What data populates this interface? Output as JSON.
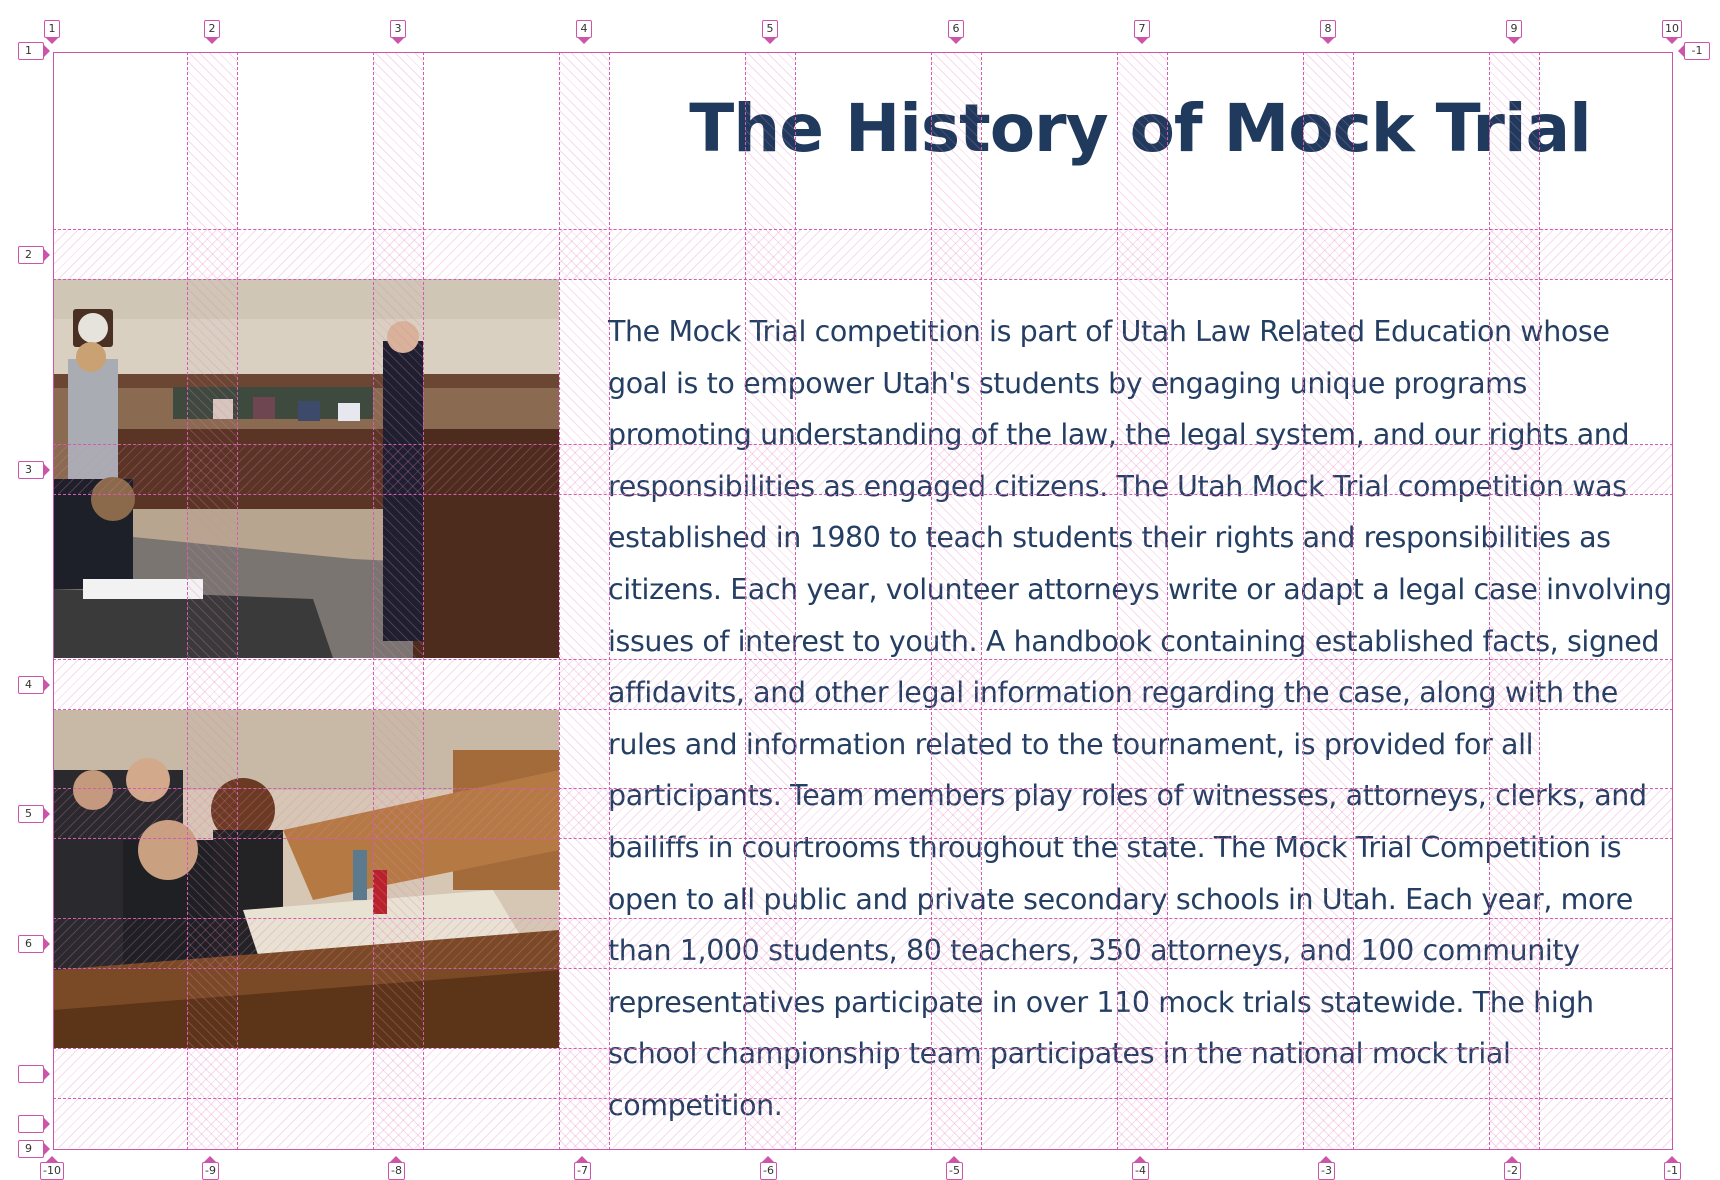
{
  "page": {
    "title": "The History of Mock Trial",
    "paragraph": "The Mock Trial competition is part of Utah Law Related Education whose goal is to empower Utah's students by engaging unique programs promoting understanding of the law, the legal system, and our rights and responsibilities as engaged citizens. The Utah Mock Trial competition was established in 1980 to teach students their rights and responsibilities as citizens. Each year, volunteer attorneys write or adapt a legal case involving issues of interest to youth. A handbook containing established facts, signed affidavits, and other legal information regarding the case, along with the rules and information related to the tournament, is provided for all participants. Team members play roles of witnesses, attorneys, clerks, and bailiffs in courtrooms throughout the state. The Mock Trial Competition is open to all public and private secondary schools in Utah. Each year, more than 1,000 students, 80 teachers, 350 attorneys, and 100 community representatives participate in over 110 mock trials statewide. The high school championship team participates in the national mock trial competition."
  },
  "grid_overlay": {
    "column_labels_top": [
      "1",
      "2",
      "3",
      "4",
      "5",
      "6",
      "7",
      "8",
      "9",
      "10"
    ],
    "column_labels_bottom": [
      "-10",
      "-9",
      "-8",
      "-7",
      "-6",
      "-5",
      "-4",
      "-3",
      "-2",
      "-1"
    ],
    "row_labels_left": [
      "1",
      "2",
      "3",
      "4",
      "5",
      "6",
      "",
      "",
      "9"
    ],
    "row_label_right": "-1",
    "colors": {
      "grid": "#cc55aa",
      "title": "#1f3a5c",
      "text": "#243f63"
    }
  }
}
